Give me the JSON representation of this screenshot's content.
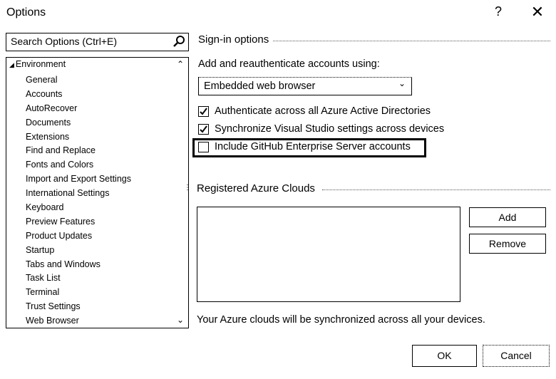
{
  "window": {
    "title": "Options",
    "help_label": "?",
    "close_label": "✕"
  },
  "search": {
    "placeholder": "Search Options (Ctrl+E)",
    "icon": "search-icon"
  },
  "tree": {
    "root": "Environment",
    "items": [
      "General",
      "Accounts",
      "AutoRecover",
      "Documents",
      "Extensions",
      "Find and Replace",
      "Fonts and Colors",
      "Import and Export Settings",
      "International Settings",
      "Keyboard",
      "Preview Features",
      "Product Updates",
      "Startup",
      "Tabs and Windows",
      "Task List",
      "Terminal",
      "Trust Settings",
      "Web Browser"
    ]
  },
  "signin": {
    "heading": "Sign-in options",
    "add_label": "Add and reauthenticate accounts using:",
    "dropdown_value": "Embedded web browser",
    "checkboxes": [
      {
        "label": "Authenticate across all Azure Active Directories",
        "checked": true
      },
      {
        "label": "Synchronize Visual Studio settings across devices",
        "checked": true
      },
      {
        "label": "Include GitHub Enterprise Server accounts",
        "checked": false
      }
    ]
  },
  "clouds": {
    "heading": "Registered Azure Clouds",
    "add_button": "Add",
    "remove_button": "Remove",
    "note": "Your Azure clouds will be synchronized across all your devices."
  },
  "footer": {
    "ok": "OK",
    "cancel": "Cancel"
  }
}
